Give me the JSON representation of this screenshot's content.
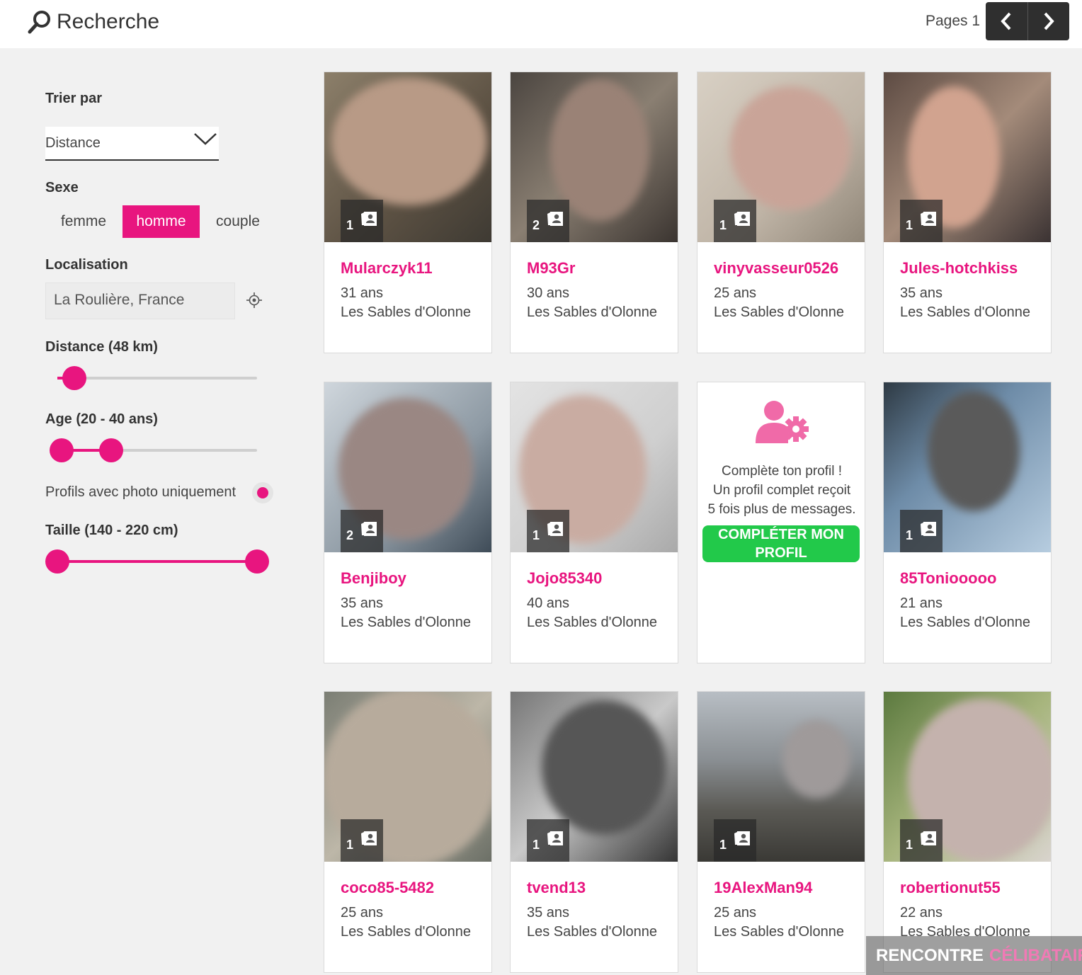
{
  "header": {
    "title": "Recherche",
    "pages_label": "Pages 1"
  },
  "sidebar": {
    "sort_label": "Trier par",
    "sort_value": "Distance",
    "sex_label": "Sexe",
    "sex_options": [
      "femme",
      "homme",
      "couple"
    ],
    "sex_selected": "homme",
    "location_label": "Localisation",
    "location_value": "La Roulière, France",
    "distance_label": "Distance (48 km)",
    "distance_km": 48,
    "age_label": "Age (20 - 40 ans)",
    "age_range": [
      20,
      40
    ],
    "photo_only_label": "Profils avec photo uniquement",
    "photo_only": true,
    "height_label": "Taille (140 - 220 cm)",
    "height_range": [
      140,
      220
    ]
  },
  "profiles": [
    {
      "name": "Mularczyk11",
      "age": "31 ans",
      "city": "Les Sables d'Olonne",
      "photos": "1"
    },
    {
      "name": "M93Gr",
      "age": "30 ans",
      "city": "Les Sables d'Olonne",
      "photos": "2"
    },
    {
      "name": "vinyvasseur0526",
      "age": "25 ans",
      "city": "Les Sables d'Olonne",
      "photos": "1"
    },
    {
      "name": "Jules-hotchkiss",
      "age": "35 ans",
      "city": "Les Sables d'Olonne",
      "photos": "1"
    },
    {
      "name": "Benjiboy",
      "age": "35 ans",
      "city": "Les Sables d'Olonne",
      "photos": "2"
    },
    {
      "name": "Jojo85340",
      "age": "40 ans",
      "city": "Les Sables d'Olonne",
      "photos": "1"
    },
    {
      "name": "85Toniooooo",
      "age": "21 ans",
      "city": "Les Sables d'Olonne",
      "photos": "1"
    },
    {
      "name": "coco85-5482",
      "age": "25 ans",
      "city": "Les Sables d'Olonne",
      "photos": "1"
    },
    {
      "name": "tvend13",
      "age": "35 ans",
      "city": "Les Sables d'Olonne",
      "photos": "1"
    },
    {
      "name": "19AlexMan94",
      "age": "25 ans",
      "city": "Les Sables d'Olonne",
      "photos": "1"
    },
    {
      "name": "robertionut55",
      "age": "22 ans",
      "city": "Les Sables d'Olonne",
      "photos": "1"
    }
  ],
  "promo": {
    "line1": "Complète ton profil !",
    "line2": "Un profil complet reçoit",
    "line3": "5 fois plus de messages.",
    "button": "COMPLÉTER MON PROFIL"
  },
  "watermark": {
    "part1": "RENCONTRE",
    "part2": "CÉLIBATAIRE"
  },
  "colors": {
    "accent": "#e8157f",
    "cta": "#22c94a",
    "pager": "#2f2f2f"
  }
}
